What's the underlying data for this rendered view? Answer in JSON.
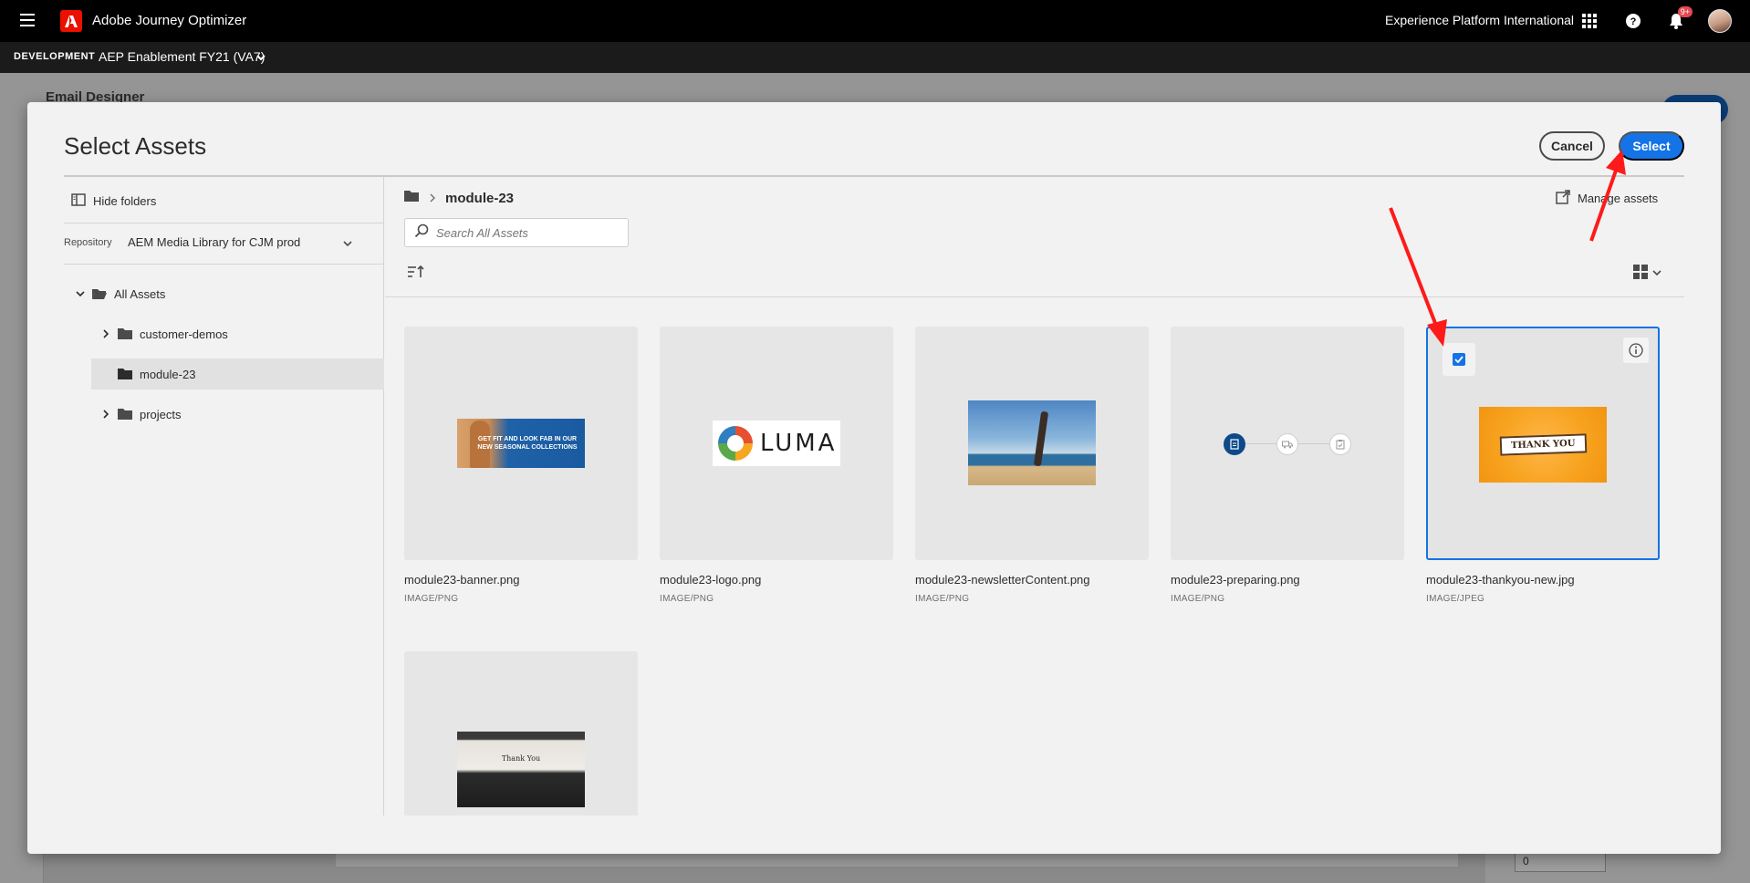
{
  "shell": {
    "app_title": "Adobe Journey Optimizer",
    "org_name": "Experience Platform International",
    "notification_count": "9+"
  },
  "sandbox": {
    "environment": "DEVELOPMENT",
    "name": "AEP Enablement FY21 (VA7)"
  },
  "background": {
    "editor_title": "Email Designer",
    "field_value": "0"
  },
  "dialog": {
    "title": "Select Assets",
    "cancel_label": "Cancel",
    "select_label": "Select"
  },
  "folders": {
    "hide_label": "Hide folders",
    "repository_label": "Repository",
    "repository_value": "AEM Media Library for CJM prod",
    "tree": [
      {
        "label": "All Assets",
        "expanded": true
      },
      {
        "label": "customer-demos",
        "expanded": false
      },
      {
        "label": "module-23",
        "selected": true
      },
      {
        "label": "projects",
        "expanded": false
      }
    ]
  },
  "assets": {
    "breadcrumb_current": "module-23",
    "manage_label": "Manage assets",
    "search_placeholder": "Search All Assets",
    "items": [
      {
        "name": "module23-banner.png",
        "type": "IMAGE/PNG",
        "banner_text": "GET FIT AND LOOK FAB IN OUR NEW SEASONAL COLLECTIONS"
      },
      {
        "name": "module23-logo.png",
        "type": "IMAGE/PNG",
        "logo_text": "LUMA"
      },
      {
        "name": "module23-newsletterContent.png",
        "type": "IMAGE/PNG"
      },
      {
        "name": "module23-preparing.png",
        "type": "IMAGE/PNG"
      },
      {
        "name": "module23-thankyou-new.jpg",
        "type": "IMAGE/JPEG",
        "selected": true,
        "ribbon_text": "THANK YOU"
      },
      {
        "name": "",
        "type": "",
        "thumb_text": "Thank You"
      }
    ]
  },
  "colors": {
    "accent": "#1473e6",
    "annotation_arrow": "#ff1a1a",
    "adobe_red": "#eb1000"
  }
}
